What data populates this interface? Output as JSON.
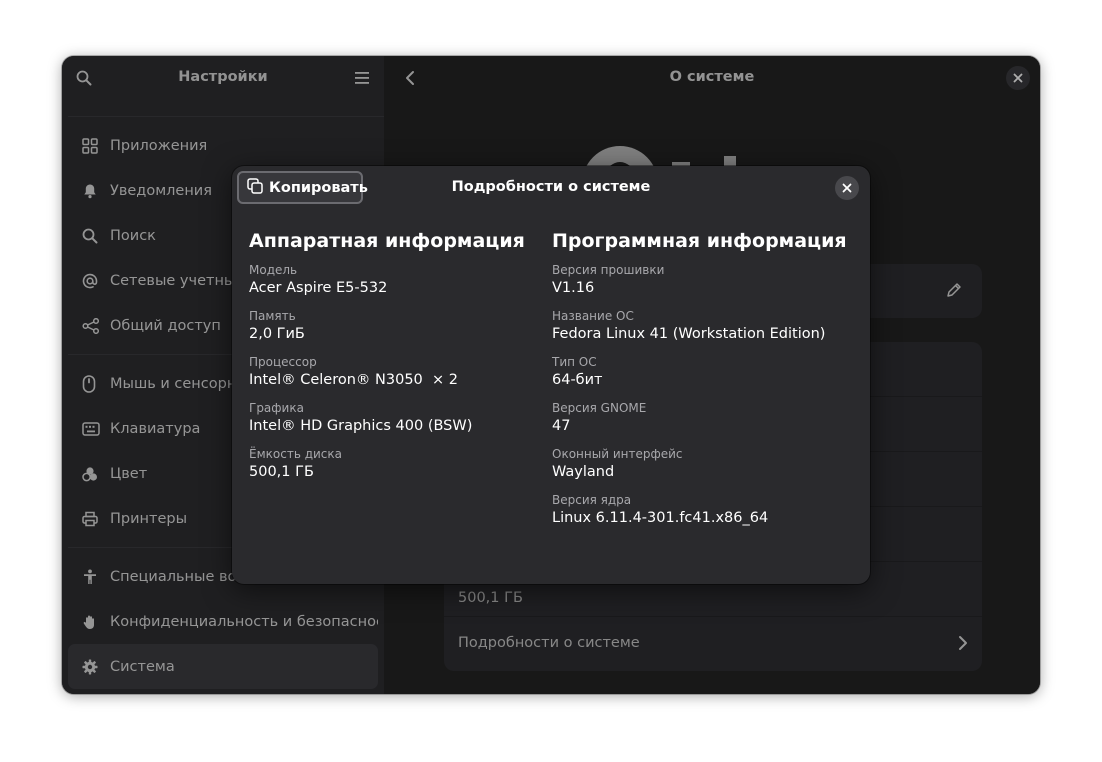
{
  "sidebar": {
    "title": "Настройки",
    "groups": [
      [
        {
          "label": "Приложения",
          "icon": "apps-grid-icon"
        },
        {
          "label": "Уведомления",
          "icon": "bell-icon"
        },
        {
          "label": "Поиск",
          "icon": "search-icon"
        },
        {
          "label": "Сетевые учетные записи",
          "icon": "at-sign-icon"
        },
        {
          "label": "Общий доступ",
          "icon": "share-icon"
        }
      ],
      [
        {
          "label": "Мышь и сенсорная панель",
          "icon": "mouse-icon"
        },
        {
          "label": "Клавиатура",
          "icon": "keyboard-icon"
        },
        {
          "label": "Цвет",
          "icon": "color-icon"
        },
        {
          "label": "Принтеры",
          "icon": "printer-icon"
        }
      ],
      [
        {
          "label": "Специальные возможности",
          "icon": "accessibility-icon"
        },
        {
          "label": "Конфиденциальность и безопасность",
          "icon": "hand-icon"
        },
        {
          "label": "Система",
          "icon": "gear-icon"
        }
      ]
    ]
  },
  "content": {
    "title": "О системе",
    "disk_value": "500,1 ГБ",
    "details_link": "Подробности о системе"
  },
  "dialog": {
    "copy_label": "Копировать",
    "title": "Подробности о системе",
    "hardware": {
      "heading": "Аппаратная информация",
      "fields": [
        {
          "label": "Модель",
          "value": "Acer Aspire E5-532"
        },
        {
          "label": "Память",
          "value": "2,0 ГиБ"
        },
        {
          "label": "Процессор",
          "value": "Intel® Celeron® N3050  × 2"
        },
        {
          "label": "Графика",
          "value": "Intel® HD Graphics 400 (BSW)"
        },
        {
          "label": "Ёмкость диска",
          "value": "500,1 ГБ"
        }
      ]
    },
    "software": {
      "heading": "Программная информация",
      "fields": [
        {
          "label": "Версия прошивки",
          "value": "V1.16"
        },
        {
          "label": "Название ОС",
          "value": "Fedora Linux 41 (Workstation Edition)"
        },
        {
          "label": "Тип ОС",
          "value": "64-бит"
        },
        {
          "label": "Версия GNOME",
          "value": "47"
        },
        {
          "label": "Оконный интерфейс",
          "value": "Wayland"
        },
        {
          "label": "Версия ядра",
          "value": "Linux 6.11.4-301.fc41.x86_64"
        }
      ]
    }
  }
}
